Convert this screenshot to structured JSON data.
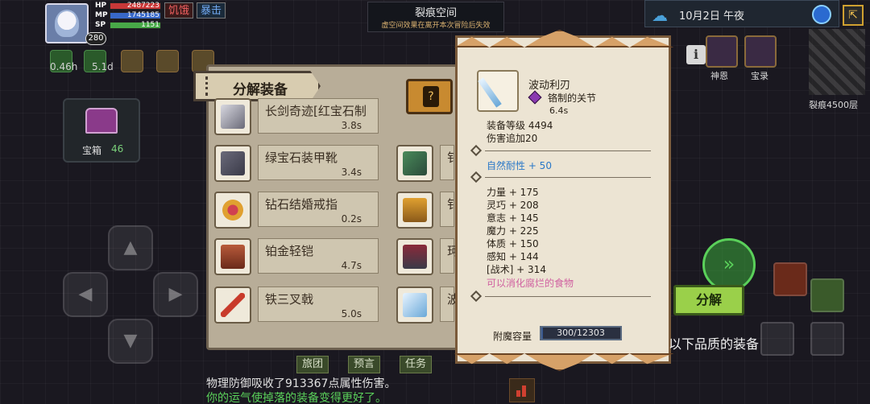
{
  "hud": {
    "level": "280",
    "hp_label": "HP",
    "hp_value": "2487223",
    "mp_label": "MP",
    "mp_value": "1745185",
    "sp_label": "SP",
    "sp_value": "1151",
    "status_hunger": "饥饿",
    "status_fight": "暴击",
    "buff_time_1": "0.46h",
    "buff_time_2": "5.1d"
  },
  "chest": {
    "label": "宝箱",
    "count": "46"
  },
  "rift": {
    "title": "裂痕空间",
    "subtitle": "虚空间效果在离开本次冒险后失效"
  },
  "date": {
    "text": "10月2日 午夜"
  },
  "menu": {
    "shen_en": "神恩",
    "bao_lu": "宝录",
    "rift_floor": "裂痕4500层"
  },
  "decompose_panel": {
    "title": "分解装备",
    "items": [
      {
        "name": "长剑奇迹[红宝石制",
        "time": "3.8s"
      },
      {
        "name": "绿宝石装甲靴",
        "time": "3.4s"
      },
      {
        "name": "钻石结婚戒指",
        "time": "0.2s"
      },
      {
        "name": "铂金轻铠",
        "time": "4.7s"
      },
      {
        "name": "铁三叉戟",
        "time": "5.0s"
      }
    ],
    "col2_chars": [
      "钅",
      "钅",
      "钅",
      "珂",
      "波"
    ]
  },
  "tooltip": {
    "name": "波动利刃",
    "material": "铬制的关节",
    "time": "6.4s",
    "equip_level": "装备等级 4494",
    "damage": "伤害追加20",
    "resistance": "自然耐性 + 50",
    "stats": [
      "力量 + 175",
      "灵巧 + 208",
      "意志 + 145",
      "魔力 + 225",
      "体质 + 150",
      "感知 + 144",
      "[战术] + 314"
    ],
    "note": "可以消化腐烂的食物",
    "enchant_label": "附魔容量",
    "enchant_value": "300/12303",
    "enchant_fraction": 0.0244
  },
  "actions": {
    "decompose_button": "分解",
    "quality_label": "以下品质的装备"
  },
  "bottom_tabs": [
    "旅团",
    "预言",
    "任务"
  ],
  "log": {
    "line1": "物理防御吸收了913367点属性伤害。",
    "line2": "你的运气使掉落的装备变得更好了。"
  },
  "colors": {
    "accent_green": "#9ad04a",
    "hp": "#c83838",
    "mp": "#3868c8",
    "sp": "#48a848"
  }
}
